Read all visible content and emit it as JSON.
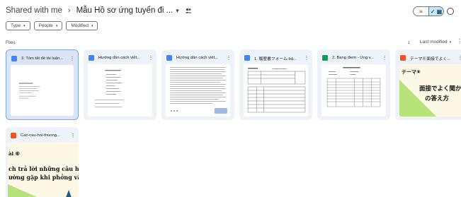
{
  "breadcrumb": {
    "root": "Shared with me",
    "separator": "›",
    "current": "Mẫu Hồ sơ ứng tuyển đi ...",
    "caret": "▾"
  },
  "view_toggle": {
    "list_icon": "≡",
    "grid_icon": "✓ ▦"
  },
  "filters": [
    {
      "label": "Type",
      "caret": "▾"
    },
    {
      "label": "People",
      "caret": "▾"
    },
    {
      "label": "Modified",
      "caret": "▾"
    }
  ],
  "files_label": "Files",
  "sort": {
    "arrow": "↓",
    "label": "Last modified",
    "caret": "▾",
    "more": "⋮"
  },
  "colors": {
    "docs_blue": "#4285f4",
    "sheets_green": "#0f9d58",
    "slides_orange": "#f4511e",
    "selected_border": "#7aa7e6"
  },
  "files": [
    {
      "title": "3. Tóm tắt đề tài luận...",
      "type": "docs",
      "icon": "docs-icon",
      "more": "⋮"
    },
    {
      "title": "Hướng dẫn cách viết...",
      "type": "docs",
      "icon": "docs-icon",
      "more": "⋮"
    },
    {
      "title": "Hướng dẫn cách viết...",
      "type": "docs",
      "icon": "docs-icon",
      "more": "⋮"
    },
    {
      "title": "1. 履歴書フォーム-bả...",
      "type": "docs",
      "icon": "docs-icon",
      "more": "⋮"
    },
    {
      "title": "2. Bang diem - Ung v...",
      "type": "sheets",
      "icon": "sheets-icon",
      "more": "⋮"
    },
    {
      "title": "テーマ⑥面接でよく...",
      "type": "slides",
      "icon": "slides-icon",
      "more": "⋮",
      "preview": {
        "line1": "テーマ⑥",
        "line2": "面接でよく聞か",
        "line3": "の答え方"
      }
    },
    {
      "title": "Cac-cau-hoi-thuong...",
      "type": "slides",
      "icon": "slides-icon",
      "more": "⋮",
      "preview": {
        "line1": "ài ⑥",
        "line2": "ch trả lời những câu h",
        "line3": "ường gặp khi phỏng vấ"
      }
    }
  ]
}
